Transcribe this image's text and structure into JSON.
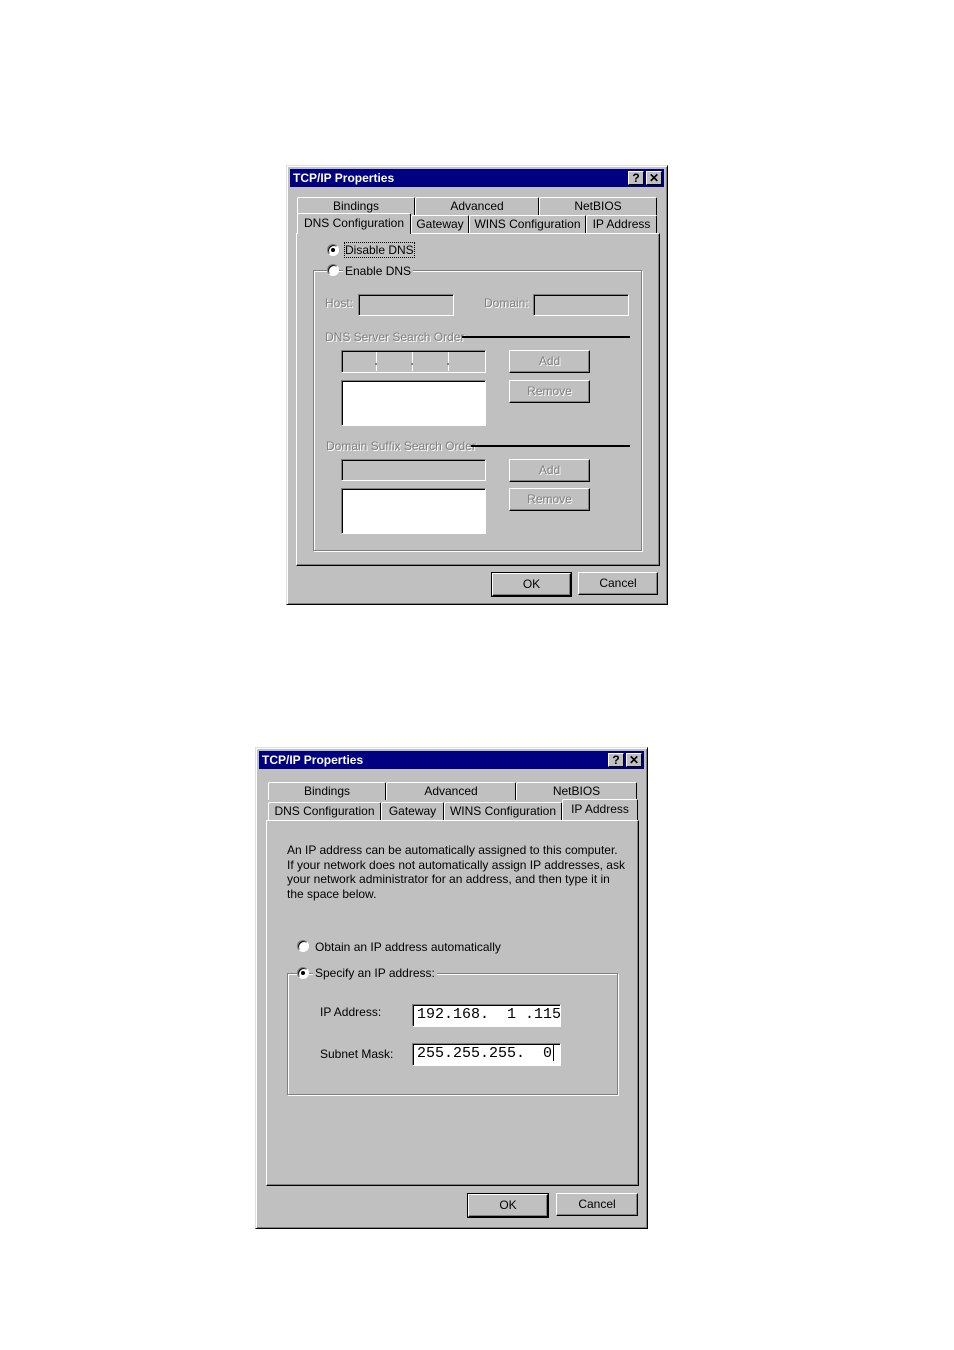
{
  "dialogs": [
    {
      "title": "TCP/IP Properties",
      "help_button": "?",
      "close_button": "✕",
      "tabs_back_row": [
        "Bindings",
        "Advanced",
        "NetBIOS"
      ],
      "tabs_front_row": [
        "DNS Configuration",
        "Gateway",
        "WINS Configuration",
        "IP Address"
      ],
      "active_tab": "DNS Configuration",
      "disable_dns": {
        "label": "Disable DNS",
        "checked": true
      },
      "enable_dns": {
        "label": "Enable DNS",
        "checked": false
      },
      "host_label": "Host:",
      "host_value": "",
      "domain_label": "Domain:",
      "domain_value": "",
      "dns_server_section": "DNS Server Search Order",
      "dns_add": "Add",
      "dns_remove": "Remove",
      "suffix_section": "Domain Suffix Search Order",
      "suffix_add": "Add",
      "suffix_remove": "Remove",
      "ok": "OK",
      "cancel": "Cancel"
    },
    {
      "title": "TCP/IP Properties",
      "help_button": "?",
      "close_button": "✕",
      "tabs_back_row": [
        "Bindings",
        "Advanced",
        "NetBIOS"
      ],
      "tabs_front_row": [
        "DNS Configuration",
        "Gateway",
        "WINS Configuration",
        "IP Address"
      ],
      "active_tab": "IP Address",
      "description": "An IP address can be automatically assigned to this computer. If your network does not automatically assign IP addresses, ask your network administrator for an address, and then type it in the space below.",
      "obtain_auto": {
        "label": "Obtain an IP address automatically",
        "checked": false
      },
      "specify": {
        "label": "Specify an IP address:",
        "checked": true
      },
      "ip_label": "IP Address:",
      "ip_value": "192.168.  1 .115",
      "mask_label": "Subnet Mask:",
      "mask_value": "255.255.255.  0",
      "ok": "OK",
      "cancel": "Cancel"
    }
  ]
}
